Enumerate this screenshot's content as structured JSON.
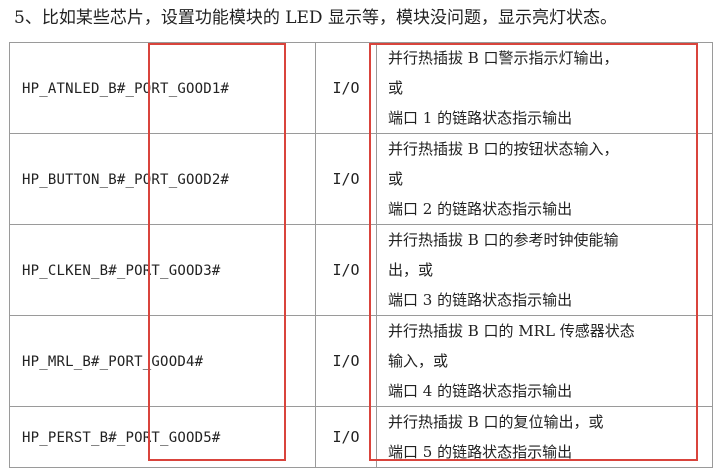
{
  "heading": "5、比如某些芯片，设置功能模块的 LED 显示等，模块没问题，显示亮灯状态。",
  "table": {
    "rows": [
      {
        "name": "HP_ATNLED_B#_PORT_GOOD1#",
        "io": "I/O",
        "desc": [
          "并行热插拔 B 口警示指示灯输出，",
          "或",
          "端口 1 的链路状态指示输出"
        ]
      },
      {
        "name": "HP_BUTTON_B#_PORT_GOOD2#",
        "io": "I/O",
        "desc": [
          "并行热插拔 B 口的按钮状态输入，",
          "或",
          "端口 2 的链路状态指示输出"
        ]
      },
      {
        "name": "HP_CLKEN_B#_PORT_GOOD3#",
        "io": "I/O",
        "desc": [
          "并行热插拔 B 口的参考时钟使能输",
          "出，或",
          "端口 3 的链路状态指示输出"
        ]
      },
      {
        "name": "HP_MRL_B#_PORT_GOOD4#",
        "io": "I/O",
        "desc": [
          "并行热插拔 B 口的 MRL 传感器状态",
          "输入，或",
          "端口 4 的链路状态指示输出"
        ]
      },
      {
        "name": "HP_PERST_B#_PORT_GOOD5#",
        "io": "I/O",
        "desc": [
          "并行热插拔 B 口的复位输出，或",
          "端口 5 的链路状态指示输出"
        ]
      }
    ]
  },
  "highlight_color": "#d9443c"
}
